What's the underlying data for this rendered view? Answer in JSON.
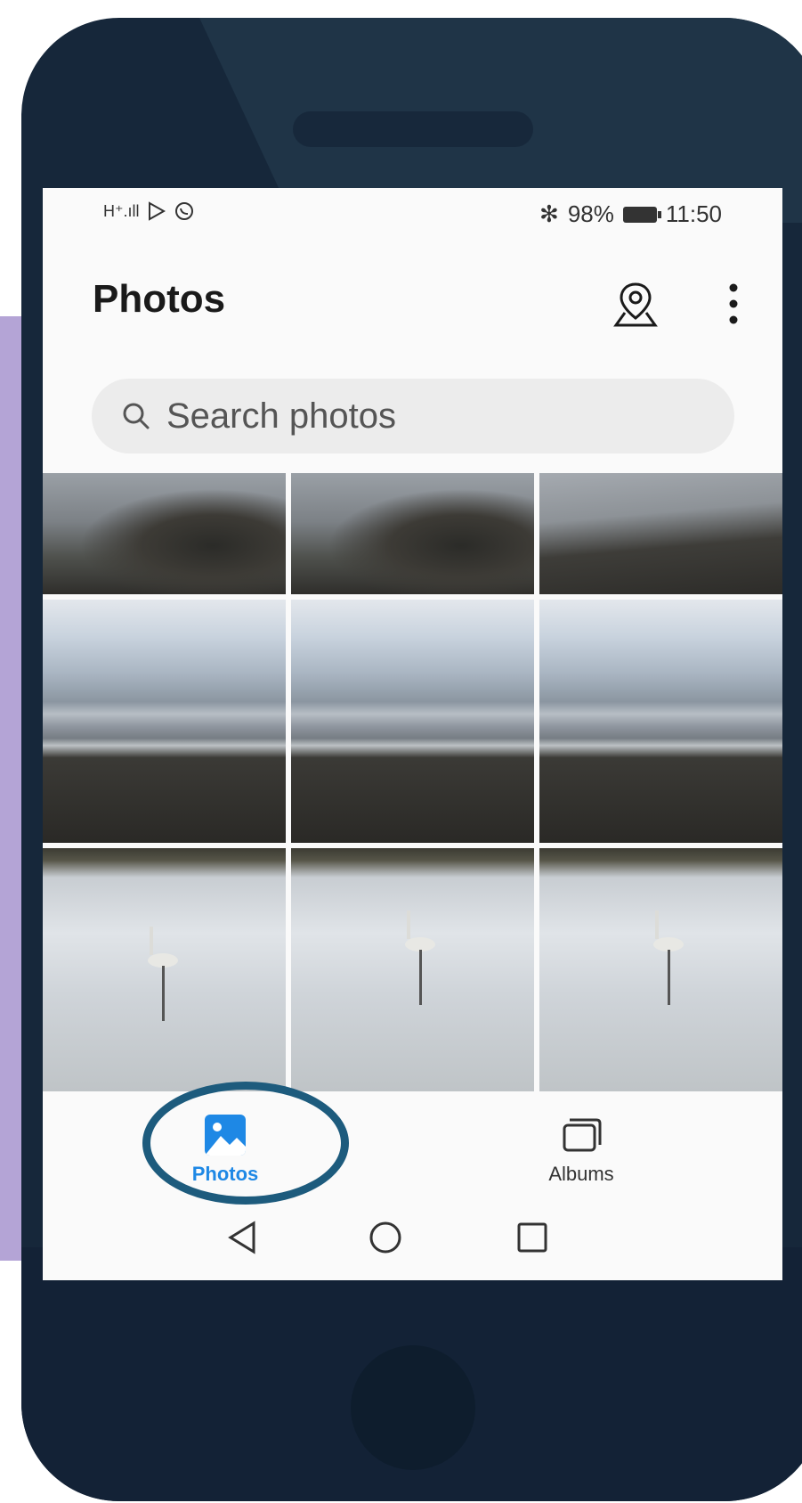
{
  "status_bar": {
    "left_icons": [
      "signal-icon",
      "play-store-icon",
      "whatsapp-icon"
    ],
    "signal_text": "H⁺.ıll",
    "bluetooth": "✻",
    "battery_percent": "98%",
    "time": "11:50"
  },
  "header": {
    "title": "Photos",
    "location_icon": "map-pin-icon",
    "more_icon": "more-vert-icon"
  },
  "search": {
    "placeholder": "Search photos"
  },
  "grid": {
    "rows": [
      [
        "rocky-shore",
        "rocky-shore",
        "beach-shore"
      ],
      [
        "beach-sky",
        "beach-sky",
        "beach-sky"
      ],
      [
        "flamingo-water",
        "flamingo-water",
        "flamingo-water"
      ]
    ]
  },
  "bottom_nav": {
    "tabs": [
      {
        "label": "Photos",
        "icon": "photos-icon",
        "active": true
      },
      {
        "label": "Albums",
        "icon": "albums-icon",
        "active": false
      }
    ]
  },
  "system_nav": {
    "buttons": [
      "back-icon",
      "home-icon",
      "recents-icon"
    ]
  },
  "colors": {
    "accent": "#1e88e5",
    "highlight_ring": "#1d5b7d",
    "phone_body": "#16273a",
    "side_accent": "#b4a4d6"
  }
}
